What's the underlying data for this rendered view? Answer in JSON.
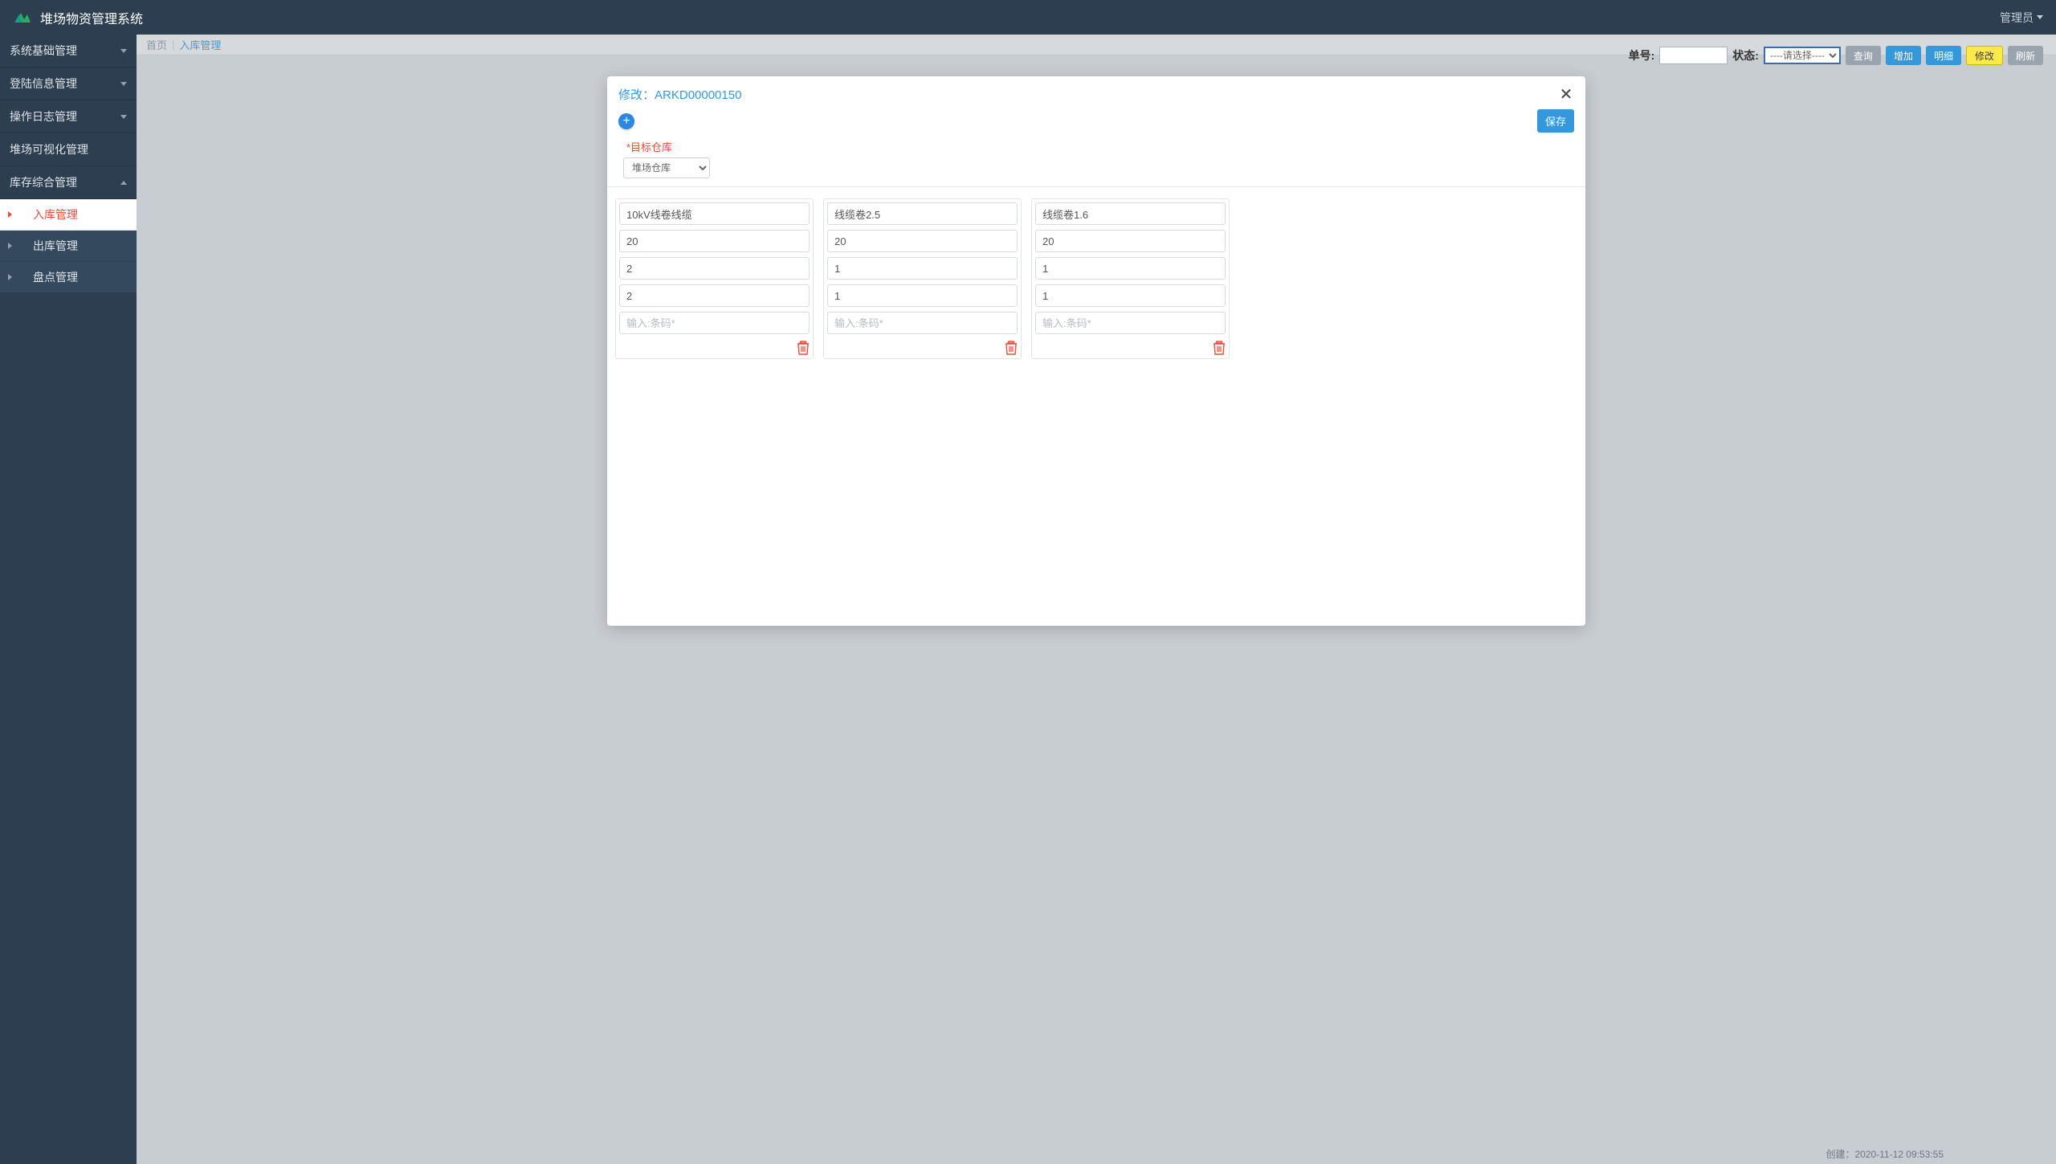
{
  "header": {
    "title": "堆场物资管理系统",
    "user": "管理员"
  },
  "sidebar": {
    "groups": [
      {
        "label": "系统基础管理",
        "expanded": false
      },
      {
        "label": "登陆信息管理",
        "expanded": false
      },
      {
        "label": "操作日志管理",
        "expanded": false
      },
      {
        "label": "堆场可视化管理",
        "expanded": false
      },
      {
        "label": "库存综合管理",
        "expanded": true,
        "items": [
          {
            "label": "入库管理",
            "active": true
          },
          {
            "label": "出库管理",
            "active": false
          },
          {
            "label": "盘点管理",
            "active": false
          }
        ]
      }
    ]
  },
  "breadcrumb": {
    "home": "首页",
    "current": "入库管理"
  },
  "toolbar": {
    "order_no_label": "单号:",
    "order_no_value": "",
    "status_label": "状态:",
    "status_placeholder": "----请选择----",
    "btn_query": "查询",
    "btn_add": "增加",
    "btn_detail": "明细",
    "btn_edit": "修改",
    "btn_refresh": "刷新"
  },
  "modal": {
    "title_prefix": "修改：",
    "record_id": "ARKD00000150",
    "save_label": "保存",
    "target_label": "*目标仓库",
    "target_value": "堆场仓库",
    "barcode_placeholder": "输入:条码*",
    "cards": [
      {
        "name": "10kV线卷线缆",
        "f2": "20",
        "f3": "2",
        "f4": "2",
        "barcode": ""
      },
      {
        "name": "线缆卷2.5",
        "f2": "20",
        "f3": "1",
        "f4": "1",
        "barcode": ""
      },
      {
        "name": "线缆卷1.6",
        "f2": "20",
        "f3": "1",
        "f4": "1",
        "barcode": ""
      }
    ]
  },
  "footer_meta": {
    "created_label": "创建：",
    "created_value": "2020-11-12 09:53:55"
  }
}
